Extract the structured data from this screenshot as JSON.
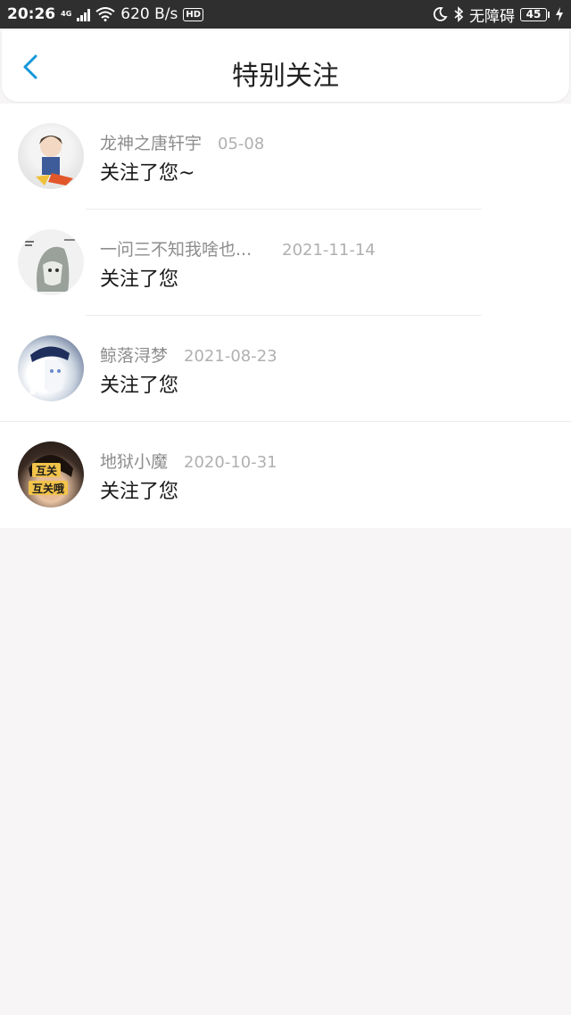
{
  "status_bar": {
    "time": "20:26",
    "network_tag": "4G",
    "net_speed": "620 B/s",
    "hd": "HD",
    "accessibility": "无障碍",
    "battery": "45"
  },
  "header": {
    "title": "特别关注"
  },
  "notifications": [
    {
      "name": "龙神之唐轩宇",
      "date": "05-08",
      "message": "关注了您~"
    },
    {
      "name": "一问三不知我啥也...",
      "date": "2021-11-14",
      "message": "关注了您"
    },
    {
      "name": "鲸落浔梦",
      "date": "2021-08-23",
      "message": "关注了您"
    },
    {
      "name": "地狱小魔",
      "date": "2020-10-31",
      "message": "关注了您"
    }
  ],
  "avatar4_text": [
    "互关",
    "互关哦"
  ],
  "colors": {
    "accent": "#1296db",
    "status_bar_bg": "#2f2f2f",
    "page_bg": "#f7f5f6"
  }
}
